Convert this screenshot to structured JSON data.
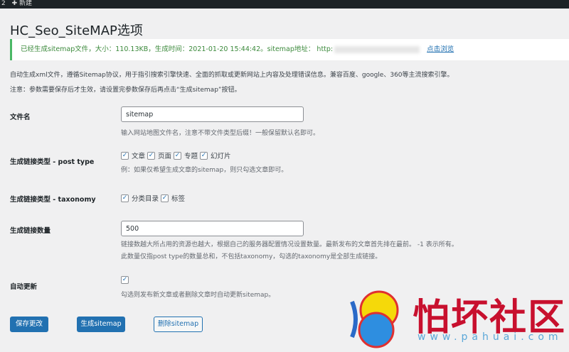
{
  "adminbar": {
    "left": "2",
    "new_label": "✚ 新建"
  },
  "page_title": "HC_Seo_SiteMAP选项",
  "notice": {
    "text": "已经生成sitemap文件，大小：110.13KB，生成时间：2021-01-20 15:44:42。sitemap地址： http:",
    "link": "点击浏览"
  },
  "intro": "自动生成xml文件，遵循Sitemap协议，用于指引搜索引擎快速、全面的抓取或更新网站上内容及处理错误信息。兼容百度、google、360等主流搜索引擎。",
  "note": "注意：参数需要保存后才生效，请设置完参数保存后再点击“生成sitemap”按钮。",
  "fields": {
    "filename": {
      "label": "文件名",
      "value": "sitemap",
      "help": "输入网站地图文件名，注意不带文件类型后缀！一般保留默认名即可。"
    },
    "post_type": {
      "label": "生成链接类型 - post type",
      "options": [
        {
          "label": "文章",
          "checked": true
        },
        {
          "label": "页面",
          "checked": true
        },
        {
          "label": "专题",
          "checked": true
        },
        {
          "label": "幻灯片",
          "checked": true
        }
      ],
      "help": "例：如果仅希望生成文章的sitemap，则只勾选文章即可。"
    },
    "taxonomy": {
      "label": "生成链接类型 - taxonomy",
      "options": [
        {
          "label": "分类目录",
          "checked": true
        },
        {
          "label": "标签",
          "checked": true
        }
      ]
    },
    "count": {
      "label": "生成链接数量",
      "value": "500",
      "help1": "链接数越大所占用的资源也越大，根据自己的服务器配置情况设置数量。最新发布的文章首先排在最前。 -1 表示所有。",
      "help2": "此数量仅指post type的数量总和，不包括taxonomy，勾选的taxonomy是全部生成链接。"
    },
    "auto_update": {
      "label": "自动更新",
      "checked": true,
      "help": "勾选则发布新文章或者删除文章时自动更新sitemap。"
    }
  },
  "buttons": {
    "save": "保存更改",
    "generate": "生成sitemap",
    "delete": "删除sitemap"
  },
  "watermark": {
    "name": "怕坏社区",
    "url": "www.pahuai.com"
  }
}
